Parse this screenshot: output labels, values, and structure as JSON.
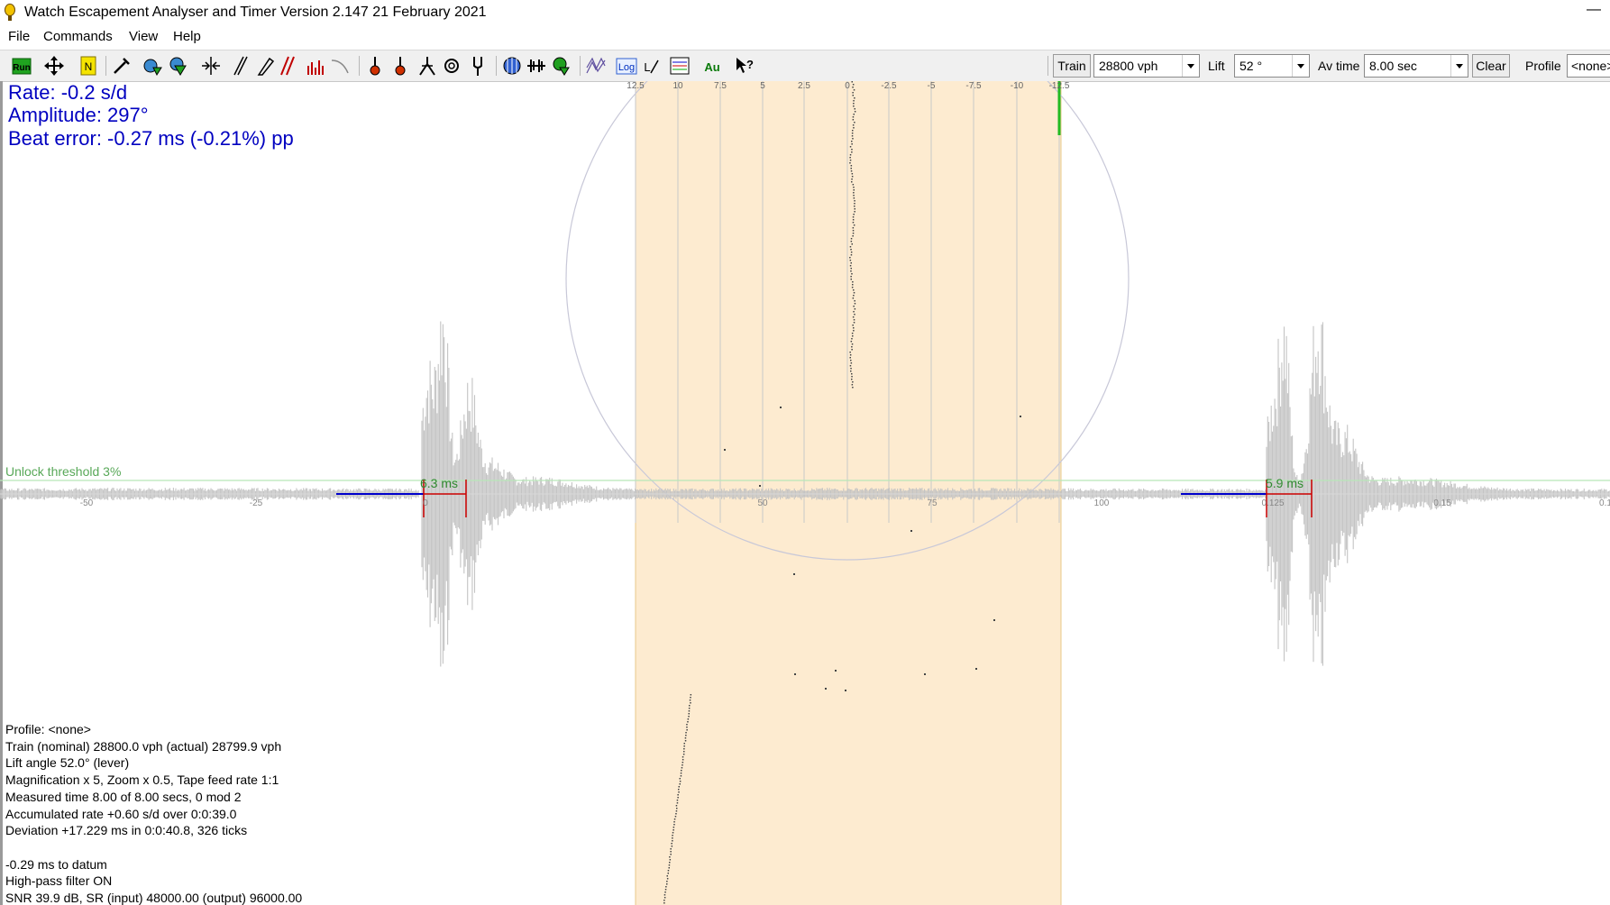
{
  "window": {
    "title": "Watch Escapement Analyser and Timer  Version 2.147 21 February 2021",
    "minimize_glyph": "—"
  },
  "menu": {
    "items": [
      "File",
      "Commands",
      "View",
      "Help"
    ]
  },
  "toolbar": {
    "icons": [
      "run-icon",
      "move-icon",
      "marker-icon",
      "probe-icon",
      "settings-icon",
      "filter-icon",
      "center-icon",
      "slash-icon",
      "pencil-icon",
      "double-slash-icon",
      "histogram-icon",
      "curve-icon",
      "pin-icon",
      "pin-alt-icon",
      "tweezers-icon",
      "gear-icon",
      "tuning-fork-icon",
      "circle-grid-icon",
      "waveform-icon",
      "graph-check-icon",
      "wave-stack-icon",
      "log-icon",
      "log-graph-icon",
      "chart-lines-icon",
      "au-icon",
      "help-icon"
    ],
    "log_label": "Log",
    "au_label": "Au",
    "train_button": "Train",
    "train_value": "28800 vph",
    "lift_label": "Lift",
    "lift_value": "52 °",
    "avtime_label": "Av time",
    "avtime_value": "8.00 sec",
    "clear_button": "Clear",
    "profile_label": "Profile",
    "profile_value": "<none>"
  },
  "readouts": {
    "rate": "Rate: -0.2 s/d",
    "amplitude": "Amplitude: 297°",
    "beat_error": "Beat error: -0.27 ms (-0.21%) pp"
  },
  "scope": {
    "unlock_threshold": "Unlock threshold 3%",
    "ms_left": "6.3 ms",
    "ms_right": "5.9 ms",
    "top_ticks": [
      "12.5",
      "10",
      "7.5",
      "5",
      "2.5",
      "0",
      "-2.5",
      "-5",
      "-7.5",
      "-10",
      "-12.5"
    ],
    "bottom_ticks": [
      "-50",
      "-25",
      "0",
      "50",
      "75",
      "100",
      "0.125",
      "0.15",
      "0.1"
    ],
    "colors": {
      "band": "#fdebd0",
      "waveform": "#c4c4c4",
      "trace": "#0000cc",
      "marker": "#cc0000",
      "threshold": "#b8e6b8",
      "accent": "#22bb22"
    }
  },
  "info": {
    "lines": [
      "Profile: <none>",
      "Train (nominal) 28800.0 vph (actual) 28799.9 vph",
      "Lift angle 52.0° (lever)",
      "Magnification x 5, Zoom x 0.5, Tape feed rate 1:1",
      "Measured time 8.00 of 8.00 secs, 0 mod 2",
      "Accumulated rate +0.60 s/d over 0:0:39.0",
      "Deviation +17.229 ms in 0:0:40.8, 326 ticks",
      "",
      "-0.29 ms to datum",
      "High-pass filter ON",
      "SNR 39.9 dB, SR (input) 48000.00 (output) 96000.00"
    ]
  }
}
